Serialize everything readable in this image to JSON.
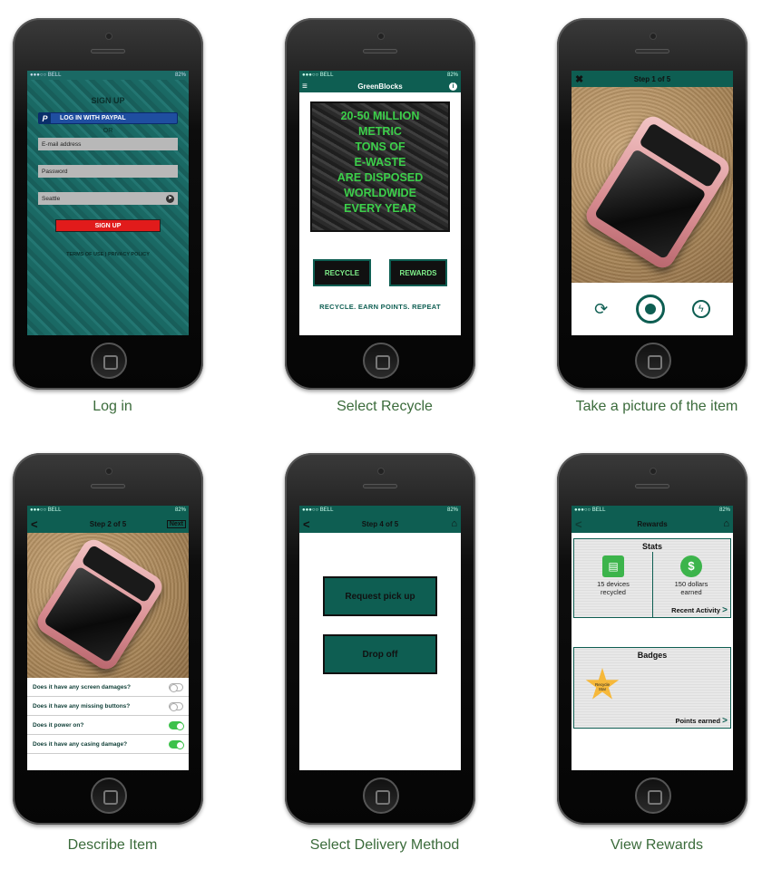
{
  "captions": [
    "Log in",
    "Select Recycle",
    "Take a picture of the item",
    "Describe Item",
    "Select Delivery Method",
    "View Rewards"
  ],
  "status": {
    "carrier": "BELL",
    "time": "4:21 PM",
    "battery": "82%"
  },
  "login": {
    "title": "SIGN UP",
    "paypal": "LOG IN WITH PAYPAL",
    "or": "OR",
    "email_placeholder": "E-mail address",
    "password_placeholder": "Password",
    "location": "Seattle",
    "signup": "SIGN UP",
    "terms": "TERMS OF USE | PRIVACY POLICY"
  },
  "recycle": {
    "app_title": "GreenBlocks",
    "fact_lines": [
      "20-50 MILLION",
      "METRIC",
      "TONS OF",
      "E-WASTE",
      "ARE DISPOSED",
      "WORLDWIDE",
      "EVERY YEAR"
    ],
    "recycle_btn": "RECYCLE",
    "rewards_btn": "REWARDS",
    "tagline": "RECYCLE. EARN POINTS. REPEAT"
  },
  "picture": {
    "step": "Step 1 of 5"
  },
  "describe": {
    "step": "Step 2 of 5",
    "next": "Next",
    "questions": [
      {
        "text": "Does it have any screen damages?",
        "on": false
      },
      {
        "text": "Does it have any missing buttons?",
        "on": false
      },
      {
        "text": "Does it power on?",
        "on": true
      },
      {
        "text": "Does it have any casing damage?",
        "on": true
      }
    ]
  },
  "delivery": {
    "step": "Step 4 of 5",
    "pickup": "Request pick up",
    "dropoff": "Drop off"
  },
  "rewards": {
    "title": "Rewards",
    "stats_title": "Stats",
    "devices": "15 devices recycled",
    "dollars": "150 dollars earned",
    "recent": "Recent Activity",
    "badges_title": "Badges",
    "badge_name": "Recycle Star",
    "points": "Points earned"
  }
}
